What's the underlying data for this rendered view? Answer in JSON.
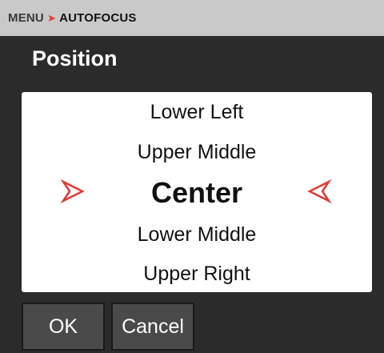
{
  "breadcrumb": {
    "root": "MENU",
    "separator": "➤",
    "current": "AUTOFOCUS"
  },
  "title": "Position",
  "picker": {
    "options": [
      "Lower Left",
      "Upper Middle",
      "Center",
      "Lower Middle",
      "Upper Right"
    ],
    "selected": "Center",
    "arrow_color": "#e53935"
  },
  "buttons": {
    "ok_label": "OK",
    "cancel_label": "Cancel"
  },
  "colors": {
    "accent": "#e53935",
    "background": "#2b2b2b",
    "header": "#c9c9c9",
    "button": "#4a4a4a"
  }
}
